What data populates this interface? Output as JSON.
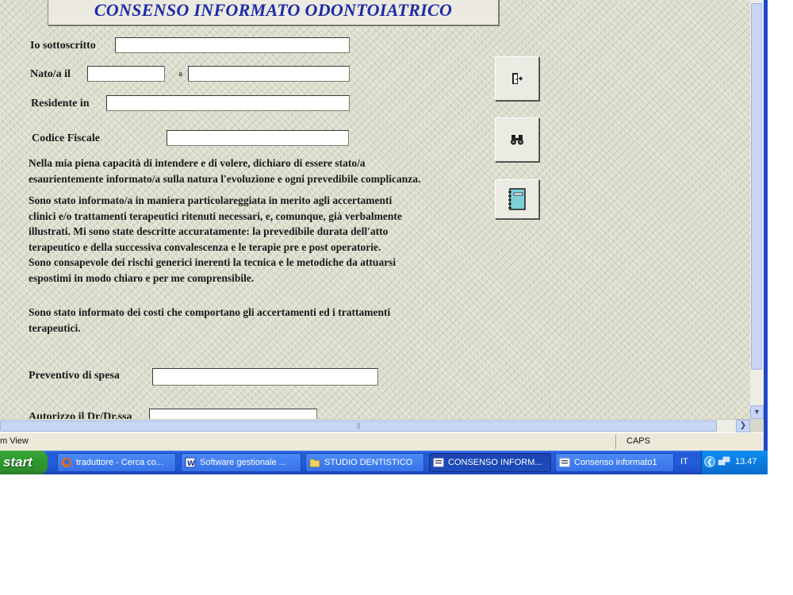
{
  "form": {
    "title": "CONSENSO INFORMATO ODONTOIATRICO",
    "fields": {
      "sottoscritto_label": "Io sottoscritto",
      "nato_label": "Nato/a il",
      "a_label": "a",
      "residente_label": "Residente in",
      "codice_fiscale_label": "Codice Fiscale",
      "preventivo_label": "Preventivo di spesa",
      "autorizzo_label": "Autorizzo il Dr/Dr.ssa"
    },
    "paragraphs": {
      "p1_l1": "Nella mia piena capacità di intendere e di volere, dichiaro di essere stato/a",
      "p1_l2": "esaurientemente informato/a sulla natura l'evoluzione e ogni prevedibile complicanza.",
      "p2_l1": "Sono  stato  informato/a  in  maniera particolareggiata  in  merito  agli  accertamenti",
      "p2_l2": "clinici  e/o trattamenti terapeutici ritenuti necessari, e, comunque, già verbalmente",
      "p2_l3": "illustrati. Mi sono state descritte accuratamente: la prevedibile durata dell'atto",
      "p2_l4": "terapeutico e della successiva convalescenza e le terapie pre e post operatorie.",
      "p3_l1": "Sono consapevole dei rischi generici inerenti la tecnica e le metodiche da attuarsi",
      "p3_l2": "espostimi in modo chiaro e per me comprensibile.",
      "p4_l1": "Sono stato informato dei costi che comportano gli accertamenti ed i trattamenti",
      "p4_l2": "terapeutici."
    },
    "toolbar_icons": [
      "exit-door-icon",
      "binoculars-icon",
      "notebook-icon"
    ]
  },
  "statusbar": {
    "left": "m View",
    "caps": "CAPS"
  },
  "taskbar": {
    "start_label": "start",
    "tasks": [
      {
        "label": "traduttore - Cerca co...",
        "icon": "firefox-icon"
      },
      {
        "label": "Software gestionale ...",
        "icon": "word-icon"
      },
      {
        "label": "STUDIO DENTISTICO",
        "icon": "folder-icon"
      },
      {
        "label": "CONSENSO INFORM...",
        "icon": "form-icon"
      },
      {
        "label": "Consenso informato1",
        "icon": "form-icon"
      }
    ],
    "language": "IT",
    "clock": "13.47"
  },
  "colors": {
    "title_text": "#1c2aa8",
    "taskbar_blue": "#245edc",
    "start_green": "#2f8f2f"
  }
}
